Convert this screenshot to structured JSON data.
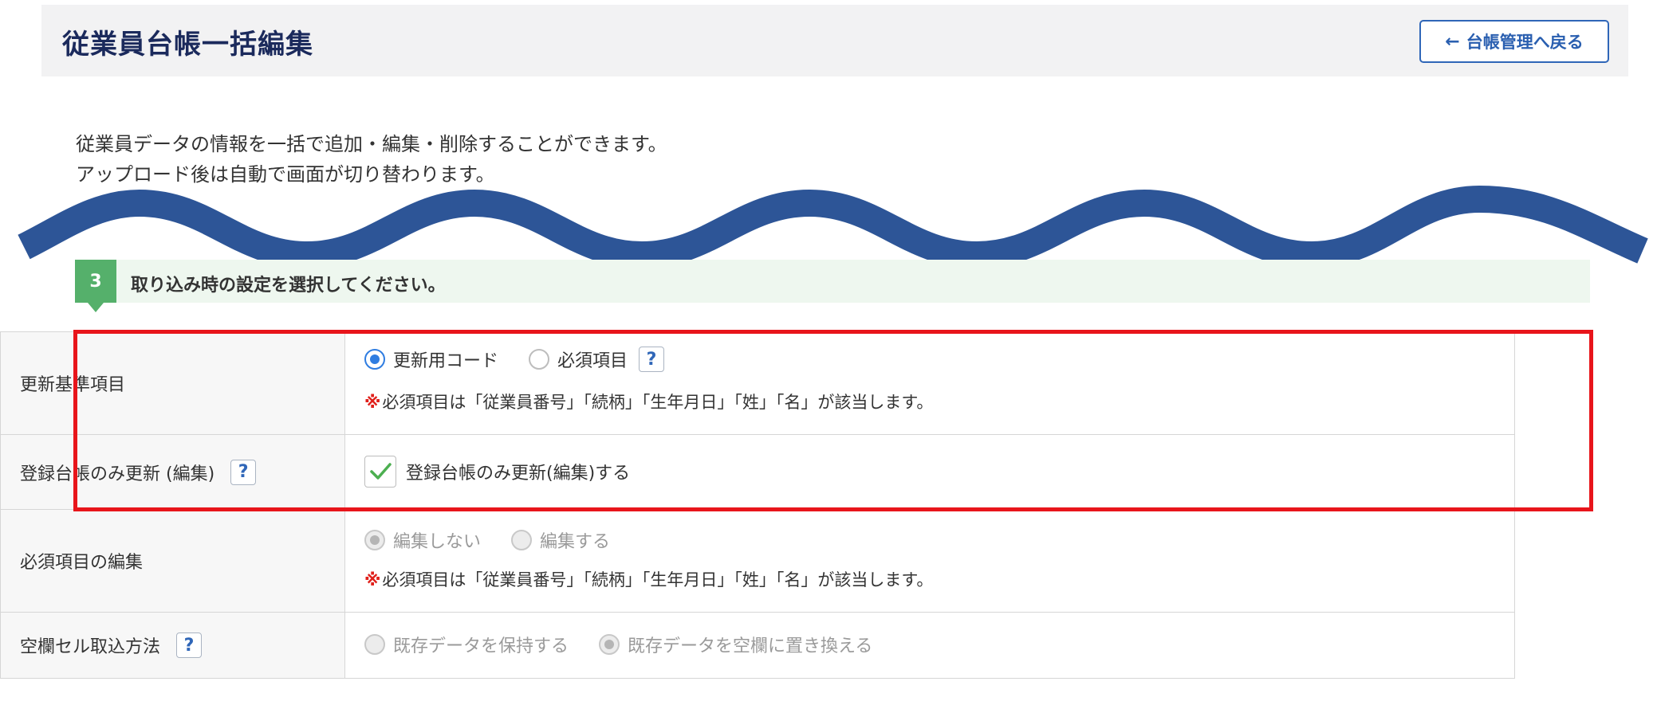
{
  "header": {
    "title": "従業員台帳一括編集",
    "back_button": "台帳管理へ戻る"
  },
  "intro": {
    "line1": "従業員データの情報を一括で追加・編集・削除することができます。",
    "line2": "アップロード後は自動で画面が切り替わります。"
  },
  "step": {
    "number": "3",
    "text": "取り込み時の設定を選択してください。"
  },
  "settings": {
    "update_key": {
      "label": "更新基準項目",
      "option1": "更新用コード",
      "option2": "必須項目",
      "selected": "更新用コード",
      "note_mark": "※",
      "note": "必須項目は「従業員番号」「続柄」「生年月日」「姓」「名」が該当します。"
    },
    "registered_only": {
      "label": "登録台帳のみ更新 (編集)",
      "checkbox_label": "登録台帳のみ更新(編集)する",
      "checked": true
    },
    "required_edit": {
      "label": "必須項目の編集",
      "option1": "編集しない",
      "option2": "編集する",
      "selected": "編集しない",
      "disabled": true,
      "note_mark": "※",
      "note": "必須項目は「従業員番号」「続柄」「生年月日」「姓」「名」が該当します。"
    },
    "blank_cells": {
      "label": "空欄セル取込方法",
      "option1": "既存データを保持する",
      "option2": "既存データを空欄に置き換える",
      "selected": "既存データを空欄に置き換える",
      "disabled": true
    }
  },
  "help_glyph": "?",
  "colors": {
    "title": "#1b2a5c",
    "accent_blue": "#2f66b8",
    "wave": "#2d5597",
    "step_green": "#55b06b",
    "highlight_red": "#e8151b",
    "note_red": "#e0201b",
    "check_green": "#4caf50"
  }
}
